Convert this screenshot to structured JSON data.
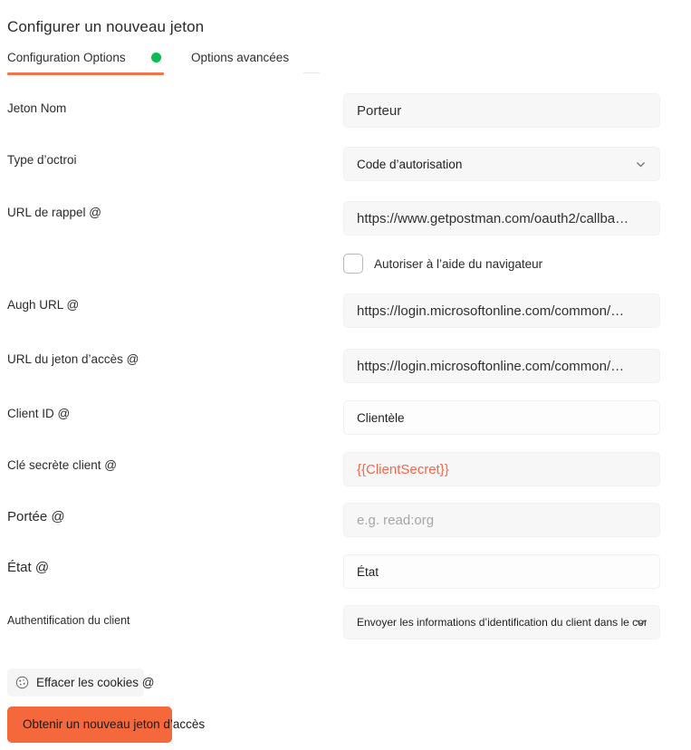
{
  "panel": {
    "title": "Configurer un nouveau jeton"
  },
  "tabs": {
    "configuration_label": "Configuration Options",
    "advanced_label": "Options avancées",
    "status_dot_color": "#0cbb52",
    "active_underline_color": "#f0754a"
  },
  "form": {
    "rows": [
      {
        "label": "Jeton    Nom",
        "value": "Porteur",
        "placeholder": "",
        "type": "text"
      },
      {
        "label": "Type d’octroi",
        "value": "Code d’autorisation",
        "placeholder": "",
        "type": "select"
      },
      {
        "label": "URL de rappel @",
        "value": "https://www.getpostman.com/oauth2/callba…",
        "placeholder": "",
        "type": "text"
      },
      {
        "label": "Augh URL @",
        "value": "https://login.microsoftonline.com/common/…",
        "placeholder": "",
        "type": "text"
      },
      {
        "label": "URL du jeton d’accès @",
        "value": "https://login.microsoftonline.com/common/…",
        "placeholder": "",
        "type": "text"
      },
      {
        "label": "Client ID @",
        "value": "Clientèle",
        "placeholder": "",
        "type": "text"
      },
      {
        "label": "Clé secrète client @",
        "value": "{{ClientSecret}}",
        "placeholder": "",
        "type": "text"
      },
      {
        "label": "Portée @",
        "value": "",
        "placeholder": "e.g. read:org",
        "type": "text"
      },
      {
        "label": "État @",
        "value": "État",
        "placeholder": "",
        "type": "text"
      },
      {
        "label": "Authentification du client",
        "value": "Envoyer les informations d’identification du client dans le corps",
        "placeholder": "",
        "type": "select"
      }
    ],
    "browser_auth_checkbox": {
      "label": "Autoriser à l’aide du navigateur",
      "checked": false
    }
  },
  "actions": {
    "clear_cookies_label": "Effacer les cookies @",
    "get_token_label": "Obtenir un nouveau jeton d’accès",
    "primary_color": "#f4683c"
  },
  "colors": {
    "field_background": "#f7f7f7",
    "secret_text": "#f4674a",
    "placeholder_text": "#a6a6a6"
  }
}
